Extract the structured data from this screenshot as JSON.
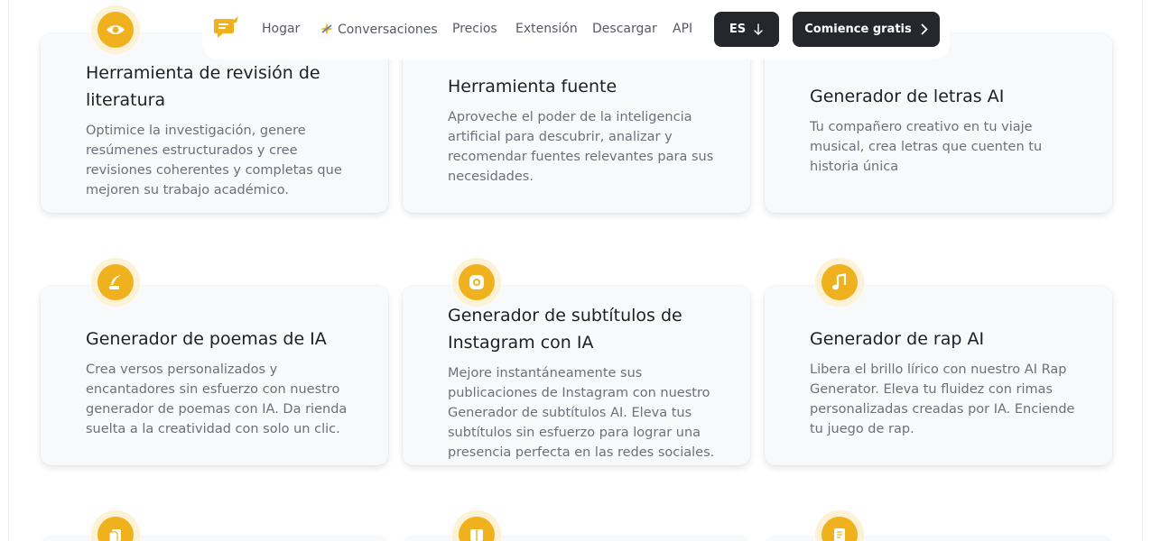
{
  "nav": {
    "links": [
      "Hogar",
      "Conversaciones",
      "Precios",
      "Extensión",
      "Descargar",
      "API"
    ],
    "lang_label": "ES",
    "cta_label": "Comience gratis"
  },
  "cards": [
    {
      "title": "Herramienta de revisión de literatura",
      "desc": "Optimice la investigación, genere resúmenes estructurados y cree revisiones coherentes y completas que mejoren su trabajo académico.",
      "icon": "eye-icon"
    },
    {
      "title": "Herramienta fuente",
      "desc": "Aproveche el poder de la inteligencia artificial para descubrir, analizar y recomendar fuentes relevantes para sus necesidades.",
      "icon": "source-icon"
    },
    {
      "title": "Generador de letras AI",
      "desc": "Tu compañero creativo en tu viaje musical, crea letras que cuenten tu historia única",
      "icon": "lyrics-icon"
    },
    {
      "title": "Generador de poemas de IA",
      "desc": "Crea versos personalizados y encantadores sin esfuerzo con nuestro generador de poemas con IA. Da rienda suelta a la creatividad con solo un clic.",
      "icon": "quill-icon"
    },
    {
      "title": "Generador de subtítulos de Instagram con IA",
      "desc": "Mejore instantáneamente sus publicaciones de Instagram con nuestro Generador de subtítulos AI. Eleva tus subtítulos sin esfuerzo para lograr una presencia perfecta en las redes sociales.",
      "icon": "instagram-icon"
    },
    {
      "title": "Generador de rap AI",
      "desc": "Libera el brillo lírico con nuestro AI Rap Generator. Eleva tu fluidez con rimas personalizadas creadas por IA. Enciende tu juego de rap.",
      "icon": "music-note-icon"
    }
  ],
  "colors": {
    "accent": "#efb21e",
    "accent_soft": "#fdf1d6",
    "dark_button": "#25272c",
    "card_bg": "#f8f9fb"
  }
}
